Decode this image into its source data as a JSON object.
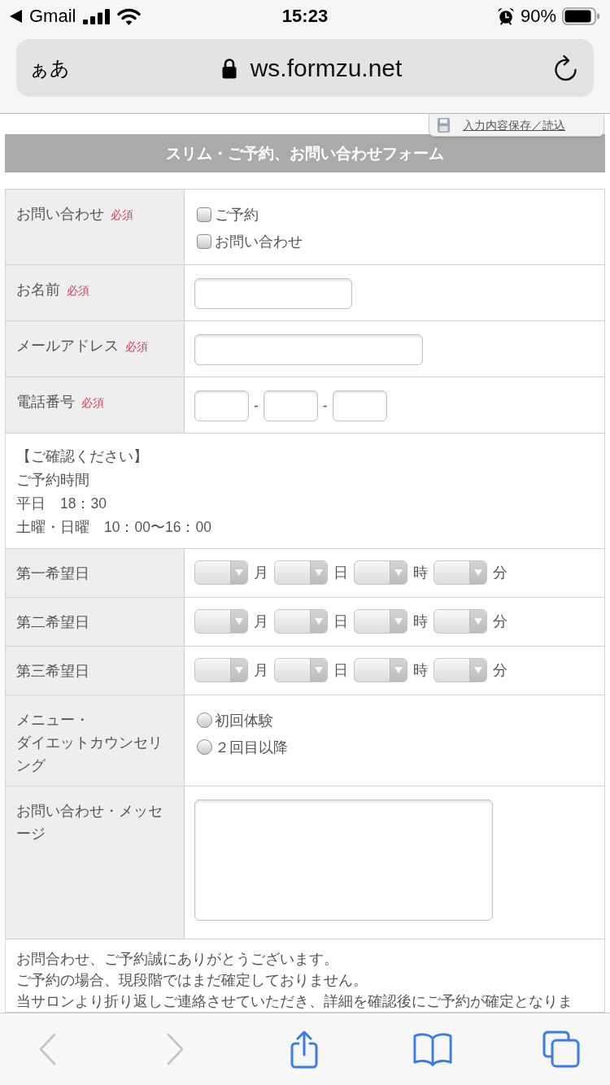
{
  "status_bar": {
    "back_app": "Gmail",
    "time": "15:23",
    "battery": "90%"
  },
  "browser": {
    "text_size_button": "ぁあ",
    "url": "ws.formzu.net"
  },
  "save_link": "入力内容保存／読込",
  "form": {
    "title": "スリム・ご予約、お問い合わせフォーム",
    "rows": [
      {
        "kind": "checkboxes",
        "label": "お問い合わせ",
        "required_mark": "必須",
        "options": [
          {
            "label": "ご予約",
            "checked": false
          },
          {
            "label": "お問い合わせ",
            "checked": false
          }
        ]
      },
      {
        "kind": "text",
        "label": "お名前",
        "required_mark": "必須"
      },
      {
        "kind": "email",
        "label": "メールアドレス",
        "required_mark": "必須"
      },
      {
        "kind": "phone",
        "label": "電話番号",
        "required_mark": "必須",
        "separators": [
          "-",
          "-"
        ]
      },
      {
        "kind": "notice",
        "lines": [
          "【ご確認ください】",
          "ご予約時間",
          "平日　18：30",
          "土曜・日曜　10：00〜16：00"
        ]
      },
      {
        "kind": "datetime",
        "label": "第一希望日",
        "units": [
          "月",
          "日",
          "時",
          "分"
        ]
      },
      {
        "kind": "datetime",
        "label": "第二希望日",
        "units": [
          "月",
          "日",
          "時",
          "分"
        ]
      },
      {
        "kind": "datetime",
        "label": "第三希望日",
        "units": [
          "月",
          "日",
          "時",
          "分"
        ]
      },
      {
        "kind": "radios",
        "label_lines": [
          "メニュー・",
          "ダイエットカウンセリ",
          "ング"
        ],
        "options": [
          {
            "label": "初回体験",
            "selected": false
          },
          {
            "label": "２回目以降",
            "selected": false
          }
        ]
      },
      {
        "kind": "textarea",
        "label_lines": [
          "お問い合わせ・メッセ",
          "ージ"
        ]
      },
      {
        "kind": "notice",
        "lines": [
          "お問合わせ、ご予約誠にありがとうございます。",
          "ご予約の場合、現段階ではまだ確定しておりません。",
          "当サロンより折り返しご連絡させていただき、詳細を確認後にご予約が確定となりま"
        ]
      }
    ]
  },
  "toolbar": {
    "back": {
      "disabled": true
    },
    "forward": {
      "disabled": true
    }
  }
}
